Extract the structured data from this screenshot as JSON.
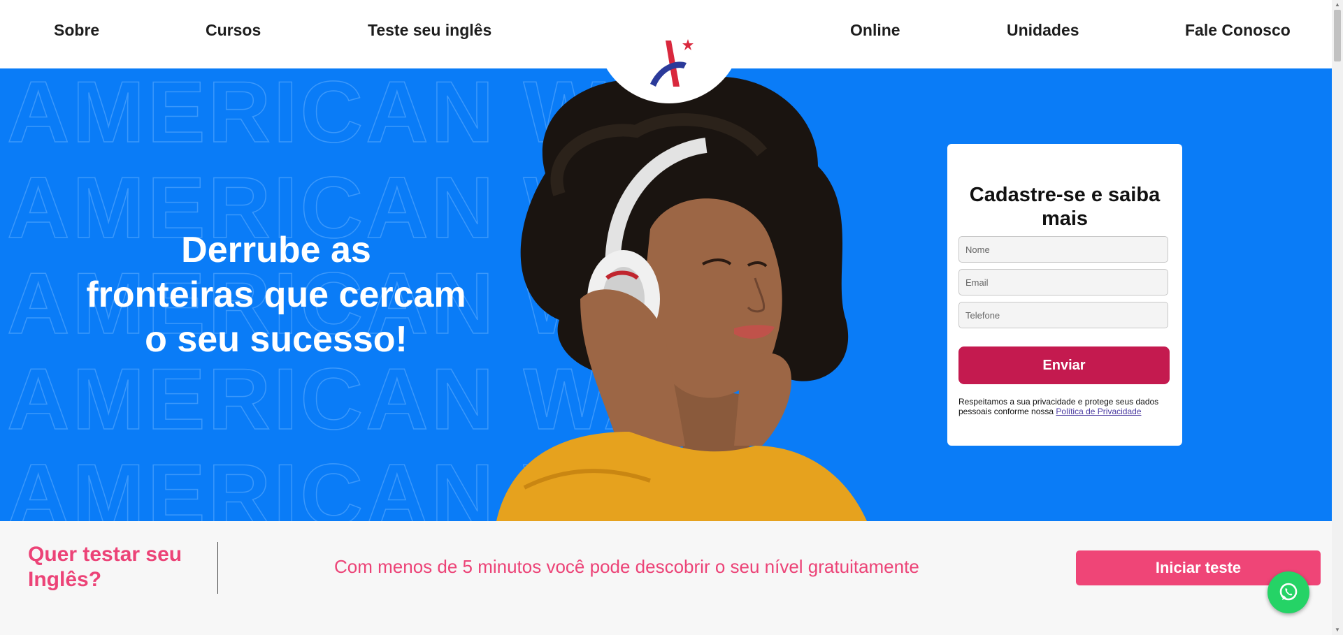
{
  "nav": {
    "left": [
      "Sobre",
      "Cursos",
      "Teste seu inglês"
    ],
    "right": [
      "Online",
      "Unidades",
      "Fale Conosco"
    ]
  },
  "hero": {
    "background_word": "AMERICAN WAY",
    "headline_lines": [
      "Derrube as",
      "fronteiras que cercam",
      "o seu sucesso!"
    ]
  },
  "form": {
    "title": "Cadastre-se e saiba mais",
    "name_placeholder": "Nome",
    "email_placeholder": "Email",
    "phone_placeholder": "Telefone",
    "submit_label": "Enviar",
    "privacy_text": "Respeitamos a sua privacidade e protege seus dados pessoais conforme nossa",
    "privacy_link": "Política de Privacidade"
  },
  "test_band": {
    "title": "Quer testar seu Inglês?",
    "description": "Com menos de 5 minutos você pode descobrir o seu nível gratuitamente",
    "button_label": "Iniciar teste"
  },
  "colors": {
    "hero_blue": "#0a7cf7",
    "send_button": "#c41a4f",
    "accent_pink": "#ec4377",
    "whatsapp_green": "#25d366"
  },
  "icons": [
    "logo-icon",
    "whatsapp-icon"
  ]
}
